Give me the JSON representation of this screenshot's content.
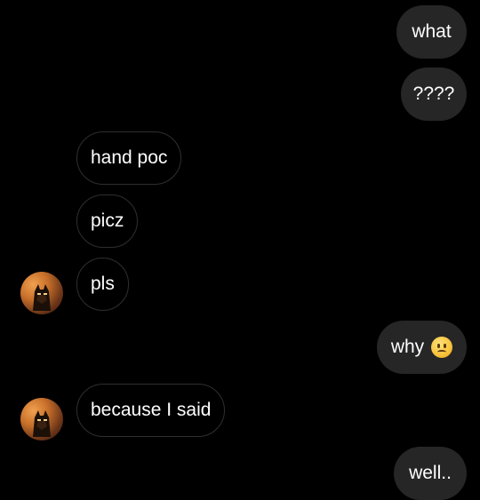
{
  "conversation": {
    "messages": [
      {
        "sender": "me",
        "text": "what"
      },
      {
        "sender": "me",
        "text": "????"
      },
      {
        "sender": "them",
        "text": "hand poc"
      },
      {
        "sender": "them",
        "text": "picz"
      },
      {
        "sender": "them",
        "text": "pls"
      },
      {
        "sender": "me",
        "text": "why",
        "emoji": "frowning-face"
      },
      {
        "sender": "them",
        "text": "because I said"
      },
      {
        "sender": "me",
        "text": "well.."
      }
    ],
    "avatar": {
      "icon": "batman-avatar-icon"
    }
  },
  "colors": {
    "background": "#000000",
    "sent_bubble": "#262626",
    "received_border": "#2f2f2f",
    "text": "#ffffff"
  }
}
